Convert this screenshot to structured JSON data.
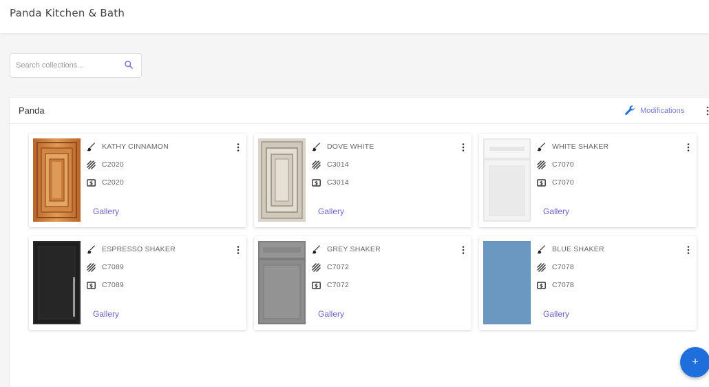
{
  "header": {
    "title": "Panda Kitchen & Bath"
  },
  "search": {
    "placeholder": "Search collections..."
  },
  "panel": {
    "title": "Panda",
    "modifications_label": "Modifications"
  },
  "cards": [
    {
      "name": "KATHY CINNAMON",
      "style_code": "C2020",
      "price_code": "C2020",
      "gallery_label": "Gallery"
    },
    {
      "name": "DOVE WHITE",
      "style_code": "C3014",
      "price_code": "C3014",
      "gallery_label": "Gallery"
    },
    {
      "name": "WHITE SHAKER",
      "style_code": "C7070",
      "price_code": "C7070",
      "gallery_label": "Gallery"
    },
    {
      "name": "ESPRESSO SHAKER",
      "style_code": "C7089",
      "price_code": "C7089",
      "gallery_label": "Gallery"
    },
    {
      "name": "GREY SHAKER",
      "style_code": "C7072",
      "price_code": "C7072",
      "gallery_label": "Gallery"
    },
    {
      "name": "BLUE SHAKER",
      "style_code": "C7078",
      "price_code": "C7078",
      "gallery_label": "Gallery"
    }
  ],
  "fab": {
    "label": "+"
  },
  "colors": {
    "accent": "#7b7fd6",
    "gallery_link": "#6c63c9",
    "fab": "#1e6fdc"
  },
  "icons": {
    "search": "search-icon",
    "modifications": "wrench-icon",
    "name": "paint-brush-icon",
    "style": "hatch-pattern-icon",
    "price": "dollar-icon",
    "more": "more-vert-icon",
    "add": "plus-icon"
  }
}
